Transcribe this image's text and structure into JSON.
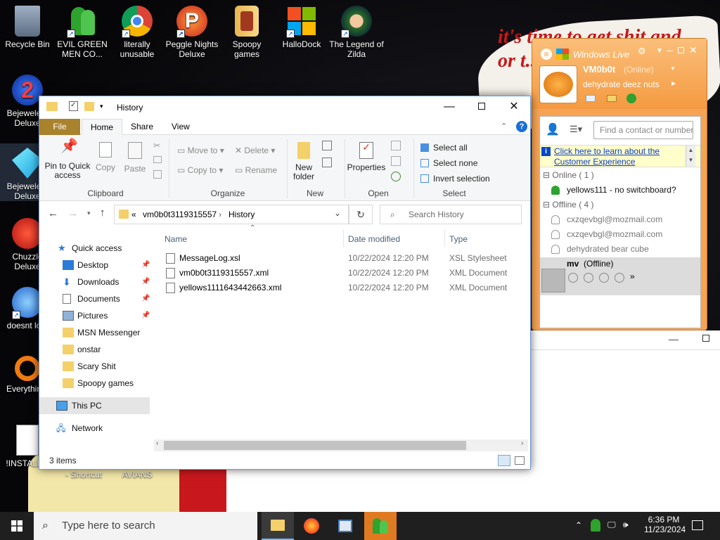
{
  "desktop": {
    "wallpaper_text": "it's time to get shit and... or t...",
    "icons_row1": [
      {
        "label": "Recycle Bin",
        "icon": "recycle-bin-icon"
      },
      {
        "label": "EVIL GREEN MEN CO...",
        "icon": "msn-people-icon"
      },
      {
        "label": "literally unusable",
        "icon": "chrome-icon"
      },
      {
        "label": "Peggle Nights Deluxe",
        "icon": "peggle-icon"
      },
      {
        "label": "Spoopy games",
        "icon": "folder-icon"
      },
      {
        "label": "HalloDock",
        "icon": "windows-logo-icon"
      },
      {
        "label": "The Legend of Zilda",
        "icon": "zilda-icon"
      }
    ],
    "icons_left": [
      {
        "label": "Bejewele... Deluxe",
        "icon": "bejeweled-icon"
      },
      {
        "label": "Bejewele... Deluxe",
        "icon": "diamond-icon"
      },
      {
        "label": "Chuzzle Deluxe",
        "icon": "chuzzle-icon"
      },
      {
        "label": "doesnt lo...",
        "icon": "thunderbird-icon"
      },
      {
        "label": "Everythin...",
        "icon": "search-ring-icon"
      },
      {
        "label": "!INSTALL...",
        "icon": "text-file-icon"
      }
    ],
    "bottom_labels": [
      "- Shortcut",
      "AVIANS"
    ]
  },
  "explorer": {
    "title": "History",
    "tabs": {
      "file": "File",
      "home": "Home",
      "share": "Share",
      "view": "View"
    },
    "ribbon": {
      "pin": "Pin to Quick access",
      "copy": "Copy",
      "paste": "Paste",
      "clipboard": "Clipboard",
      "move_to": "Move to",
      "copy_to": "Copy to",
      "delete": "Delete",
      "rename": "Rename",
      "organize": "Organize",
      "new_folder": "New folder",
      "new": "New",
      "properties": "Properties",
      "open": "Open",
      "select_all": "Select all",
      "select_none": "Select none",
      "invert": "Invert selection",
      "select": "Select"
    },
    "address": {
      "prefix": "«",
      "crumb1": "vm0b0t3119315557",
      "crumb2": "History"
    },
    "search_placeholder": "Search History",
    "nav": {
      "quick_access": "Quick access",
      "items": [
        "Desktop",
        "Downloads",
        "Documents",
        "Pictures",
        "MSN Messenger",
        "onstar",
        "Scary Shit",
        "Spoopy games"
      ],
      "this_pc": "This PC",
      "network": "Network"
    },
    "columns": {
      "name": "Name",
      "date": "Date modified",
      "type": "Type"
    },
    "files": [
      {
        "name": "MessageLog.xsl",
        "date": "10/22/2024 12:20 PM",
        "type": "XSL Stylesheet"
      },
      {
        "name": "vm0b0t3119315557.xml",
        "date": "10/22/2024 12:20 PM",
        "type": "XML Document"
      },
      {
        "name": "yellows1111643442663.xml",
        "date": "10/22/2024 12:20 PM",
        "type": "XML Document"
      }
    ],
    "status": "3 items"
  },
  "msn": {
    "brand": "Windows Live",
    "username": "VM0b0t",
    "presence": "(Online)",
    "personal_message": "dehydrate deez nuts",
    "find_placeholder": "Find a contact or number",
    "banner_line1": "Click here to learn about the",
    "banner_line2": "Customer Experience",
    "online_header": "Online ( 1 )",
    "online": [
      "yellows111 - no switchboard?"
    ],
    "offline_header": "Offline ( 4 )",
    "offline": [
      "cxzqevbgl@mozmail.com",
      "cxzqevbgl@mozmail.com",
      "dehydrated bear cube"
    ],
    "selected_contact": "mv",
    "selected_status": "(Offline)"
  },
  "taskbar": {
    "search_placeholder": "Type here to search",
    "time": "6:36 PM",
    "date": "11/23/2024"
  }
}
